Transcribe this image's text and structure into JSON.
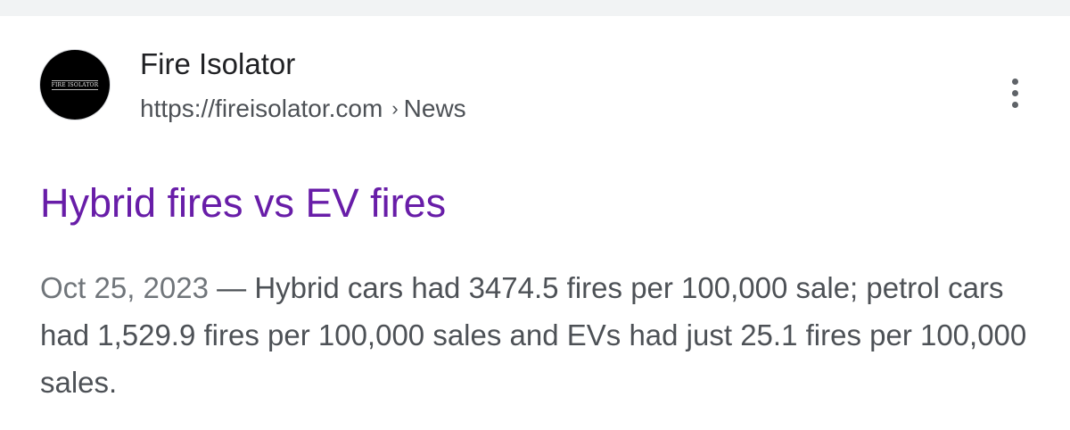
{
  "search_result": {
    "site_name": "Fire Isolator",
    "favicon_text": "FIRE ISOLATOR",
    "url": "https://fireisolator.com",
    "breadcrumb_separator": "›",
    "breadcrumb": "News",
    "title": "Hybrid fires vs EV fires",
    "date": "Oct 25, 2023",
    "date_separator": " — ",
    "snippet": "Hybrid cars had 3474.5 fires per 100,000 sale; petrol cars had 1,529.9 fires per 100,000 sales and EVs had just 25.1 fires per 100,000 sales.",
    "more_icon": "more-vert-icon"
  },
  "colors": {
    "title_visited": "#681da8",
    "text_primary": "#202124",
    "text_secondary": "#4d5156",
    "top_strip": "#f1f3f4"
  }
}
